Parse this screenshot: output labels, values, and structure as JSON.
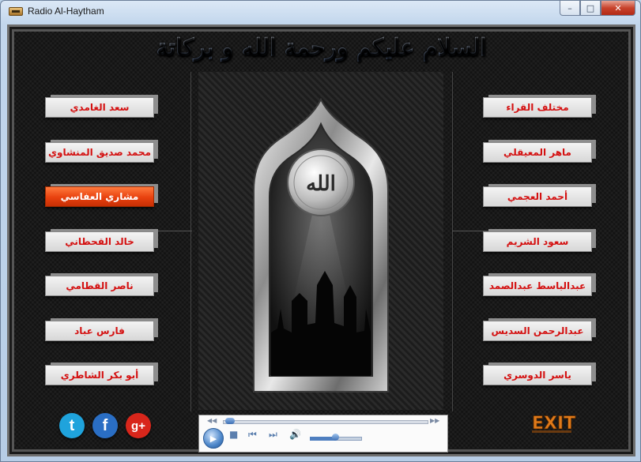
{
  "window": {
    "title": "Radio Al-Haytham",
    "minimize": "–",
    "maximize": "□",
    "close": "✕"
  },
  "heading": "السلام عليكم ورحمة الله و بركاتة",
  "calligraphy": "الله",
  "reciters_left": [
    {
      "label": "سعد الغامدي",
      "active": false
    },
    {
      "label": "محمد صديق المنشاوي",
      "active": false
    },
    {
      "label": "مشاري العفاسي",
      "active": true
    },
    {
      "label": "خالد القحطاني",
      "active": false
    },
    {
      "label": "ناصر القطامي",
      "active": false
    },
    {
      "label": "فارس عباد",
      "active": false
    },
    {
      "label": "أبو بكر الشاطري",
      "active": false
    }
  ],
  "reciters_right": [
    {
      "label": "مختلف القراء",
      "active": false
    },
    {
      "label": "ماهر المعيقلي",
      "active": false
    },
    {
      "label": "أحمد العجمي",
      "active": false
    },
    {
      "label": "سعود الشريم",
      "active": false
    },
    {
      "label": "عبدالباسط عبدالصمد",
      "active": false
    },
    {
      "label": "عبدالرحمن السديس",
      "active": false
    },
    {
      "label": "ياسر الدوسري",
      "active": false
    }
  ],
  "player": {
    "seek_position": 0.02,
    "volume": 0.5,
    "icons": [
      "rewind-icon",
      "seek-bar",
      "fast-forward-icon",
      "play-icon",
      "stop-icon",
      "previous-icon",
      "next-icon",
      "speaker-icon",
      "volume-slider"
    ]
  },
  "social": [
    {
      "name": "twitter",
      "glyph": "t",
      "color": "#1fa3dc"
    },
    {
      "name": "facebook",
      "glyph": "f",
      "color": "#2a6ec4"
    },
    {
      "name": "google-plus",
      "glyph": "g+",
      "color": "#d8261b"
    }
  ],
  "exit_label": "EXIT"
}
